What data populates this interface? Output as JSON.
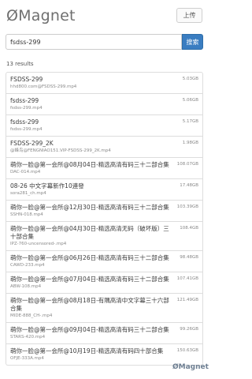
{
  "header": {
    "logo": "ØMagnet",
    "upload_label": "上传"
  },
  "search": {
    "value": "fsdss-299",
    "button_label": "搜索"
  },
  "results_count": "13 results",
  "results": [
    {
      "title": "FSDSS-299",
      "file": "hhd800.com@FSDSS-299.mp4",
      "size": "5.03GB"
    },
    {
      "title": "fsdss-299",
      "file": "fsdss-299.mp4",
      "size": "5.06GB"
    },
    {
      "title": "fsdss-299",
      "file": "fsdss-299.mp4",
      "size": "5.17GB"
    },
    {
      "title": "FSDSS-299_2K",
      "file": "@蜂鸟@FENGNIAO151.VIP-FSDSS-299_2K.mp4",
      "size": "1.98GB"
    },
    {
      "title": "萌你一脸@第一会所@08月04日-精选高清有码三十二部合集",
      "file": "DAC-014.mp4",
      "size": "108.07GB"
    },
    {
      "title": "08-26 中文字幕新作10連發",
      "file": "sora281_ch.mp4",
      "size": "17.48GB"
    },
    {
      "title": "萌你一脸@第一会所@12月30日-精选高清有码三十二部合集",
      "file": "SSHN-018.mp4",
      "size": "103.39GB"
    },
    {
      "title": "萌你一脸@第一会所@04月30日-精选高清无码（破坏版）三十部合集",
      "file": "IPZ-760-uncensored-.mp4",
      "size": "108.4GB"
    },
    {
      "title": "萌你一脸@第一会所@06月26日-精选高清有码三十二部合集",
      "file": "CAWD-233.mp4",
      "size": "98.48GB"
    },
    {
      "title": "萌你一脸@第一会所@07月04日-精选高清有码三十二部合集",
      "file": "ABW-108.mp4",
      "size": "107.41GB"
    },
    {
      "title": "萌你一脸@第一会所@08月18日-有隅高清中文字幕三十六部合集",
      "file": "MIDE-888_CH-.mp4",
      "size": "121.49GB"
    },
    {
      "title": "萌你一脸@第一会所@09月04日-精选高清有码三十二部合集",
      "file": "STARS-420.mp4",
      "size": "99.26GB"
    },
    {
      "title": "萌你一脸@第一会所@10月19日-精选高清有码四十部合集",
      "file": "OFJE-333A.mp4",
      "size": "150.63GB"
    }
  ],
  "footer": {
    "logo": "ØMagnet"
  }
}
